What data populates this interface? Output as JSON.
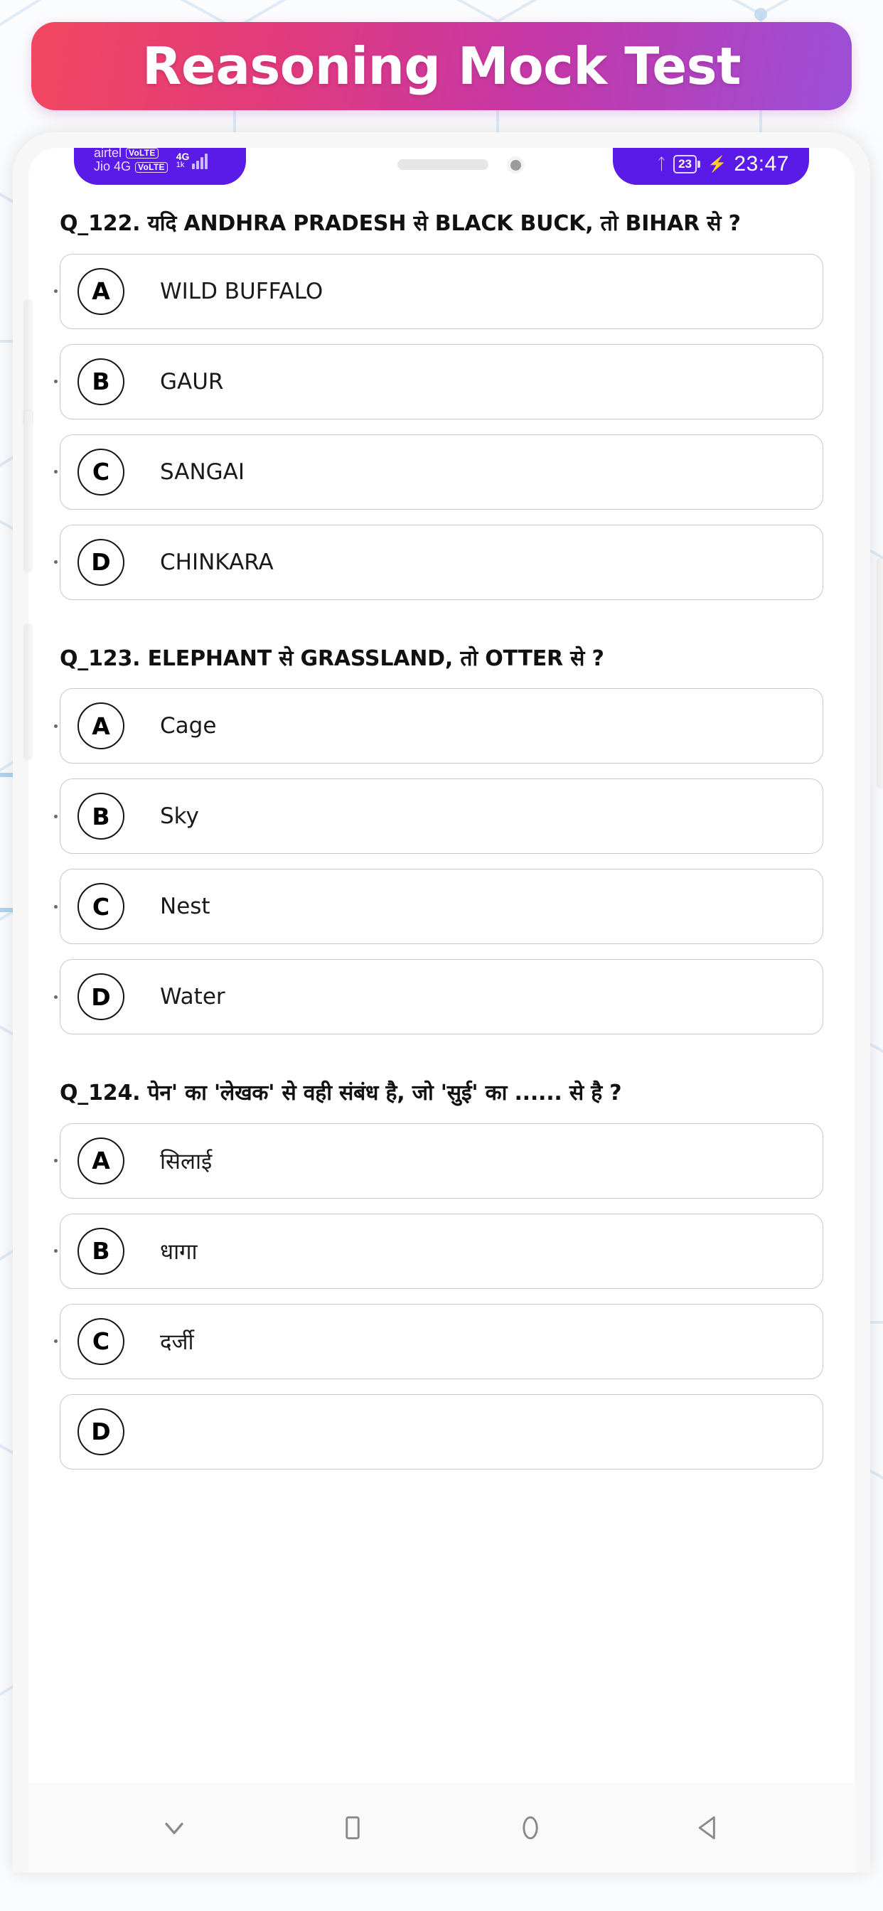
{
  "banner": {
    "title": "Reasoning Mock Test",
    "gradient_start": "#f2475f",
    "gradient_mid": "#d0339c",
    "gradient_end": "#9b4fd8"
  },
  "status_bar": {
    "background": "#5a1ae8",
    "carrier_primary": "airtel",
    "carrier_primary_badge": "VoLTE",
    "carrier_secondary": "Jio 4G",
    "carrier_secondary_badge": "VoLTE",
    "network_type": "4G",
    "network_speed": "1k",
    "bluetooth_icon": "bluetooth-icon",
    "battery_percent": "23",
    "charging_icon": "charging-bolt-icon",
    "clock": "23:47"
  },
  "hardware": {
    "speaker": "speaker-grille",
    "camera": "front-camera"
  },
  "questions": [
    {
      "text": "Q_122. यदि ANDHRA PRADESH से BLACK BUCK, तो BIHAR से ?",
      "options": [
        {
          "letter": "A",
          "text": "WILD BUFFALO"
        },
        {
          "letter": "B",
          "text": "GAUR"
        },
        {
          "letter": "C",
          "text": "SANGAI"
        },
        {
          "letter": "D",
          "text": "CHINKARA"
        }
      ]
    },
    {
      "text": "Q_123. ELEPHANT से GRASSLAND, तो OTTER से ?",
      "options": [
        {
          "letter": "A",
          "text": "Cage"
        },
        {
          "letter": "B",
          "text": "Sky"
        },
        {
          "letter": "C",
          "text": "Nest"
        },
        {
          "letter": "D",
          "text": "Water"
        }
      ]
    },
    {
      "text": "Q_124. पेन' का 'लेखक' से वही संबंध है, जो 'सुई' का ...... से है ?",
      "options": [
        {
          "letter": "A",
          "text": "सिलाई"
        },
        {
          "letter": "B",
          "text": "धागा"
        },
        {
          "letter": "C",
          "text": "दर्जी"
        },
        {
          "letter": "D",
          "text": ""
        }
      ]
    }
  ],
  "nav_bar": {
    "buttons": [
      {
        "icon": "chevron-down-icon",
        "label": "Hide keyboard"
      },
      {
        "icon": "square-icon",
        "label": "Recents"
      },
      {
        "icon": "circle-icon",
        "label": "Home"
      },
      {
        "icon": "triangle-left-icon",
        "label": "Back"
      }
    ]
  }
}
